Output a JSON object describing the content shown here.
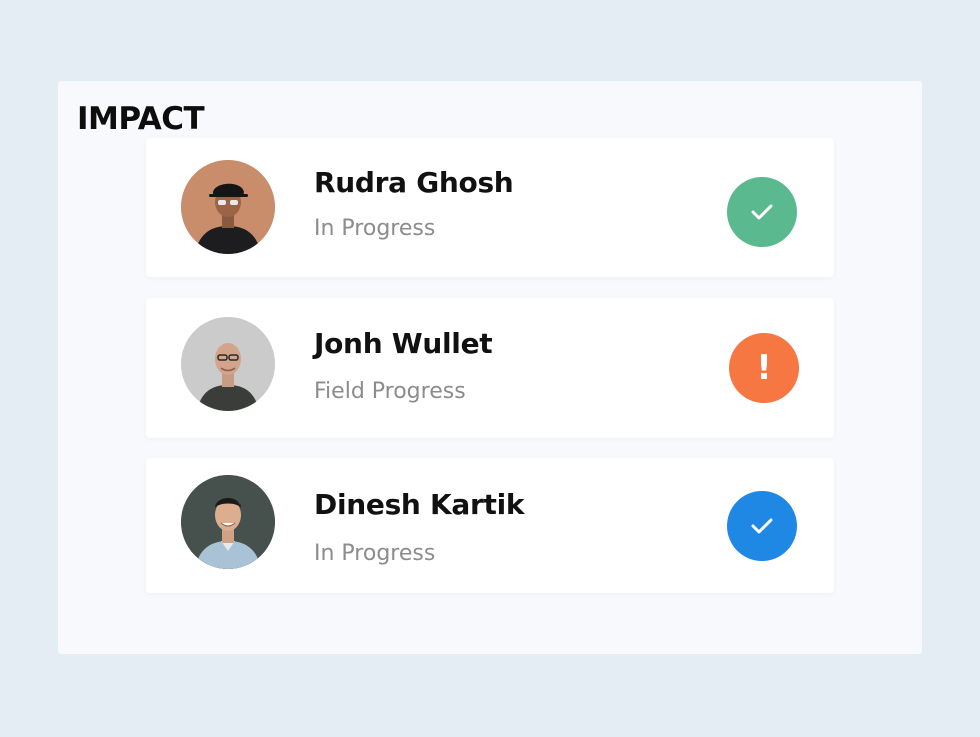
{
  "heading": "IMPACT",
  "colors": {
    "success_green": "#5bb98f",
    "warning_orange": "#f67742",
    "info_blue": "#1f88e5"
  },
  "people": [
    {
      "name": "Rudra Ghosh",
      "status": "In Progress",
      "status_icon": "check-icon",
      "status_color": "#5bb98f"
    },
    {
      "name": "Jonh Wullet",
      "status": "Field Progress",
      "status_icon": "exclamation-icon",
      "status_color": "#f67742"
    },
    {
      "name": "Dinesh Kartik",
      "status": "In Progress",
      "status_icon": "check-icon",
      "status_color": "#1f88e5"
    }
  ]
}
